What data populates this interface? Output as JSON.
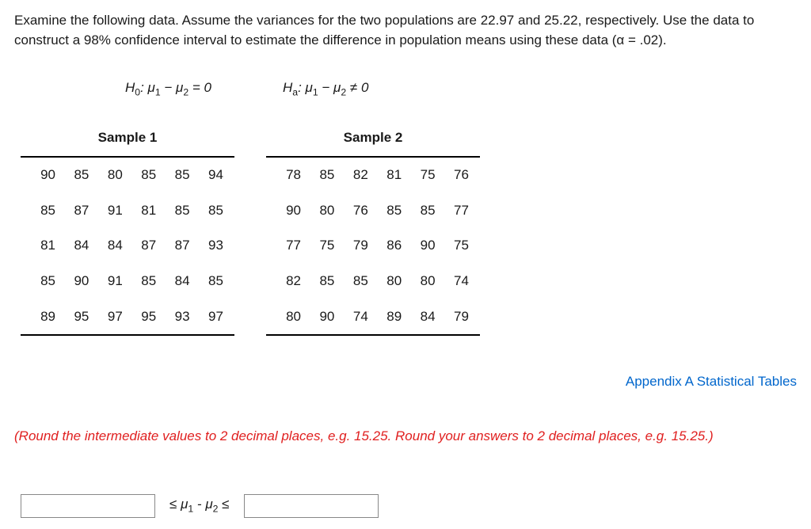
{
  "instructions": "Examine the following data. Assume the variances for the two populations are 22.97 and 25.22, respectively. Use the data to construct a 98% confidence interval to estimate the difference in population means using these data (α = .02).",
  "hypotheses": {
    "h0_prefix": "H",
    "h0_sub": "0",
    "h0_body": ": μ",
    "h0_s1": "1",
    "h0_mid": " − μ",
    "h0_s2": "2",
    "h0_end": " = 0",
    "ha_prefix": "H",
    "ha_sub": "a",
    "ha_body": ": μ",
    "ha_s1": "1",
    "ha_mid": " − μ",
    "ha_s2": "2",
    "ha_end": " ≠ 0"
  },
  "samples": [
    {
      "title": "Sample 1",
      "rows": [
        [
          "90",
          "85",
          "80",
          "85",
          "85",
          "94"
        ],
        [
          "85",
          "87",
          "91",
          "81",
          "85",
          "85"
        ],
        [
          "81",
          "84",
          "84",
          "87",
          "87",
          "93"
        ],
        [
          "85",
          "90",
          "91",
          "85",
          "84",
          "85"
        ],
        [
          "89",
          "95",
          "97",
          "95",
          "93",
          "97"
        ]
      ]
    },
    {
      "title": "Sample 2",
      "rows": [
        [
          "78",
          "85",
          "82",
          "81",
          "75",
          "76"
        ],
        [
          "90",
          "80",
          "76",
          "85",
          "85",
          "77"
        ],
        [
          "77",
          "75",
          "79",
          "86",
          "90",
          "75"
        ],
        [
          "82",
          "85",
          "85",
          "80",
          "80",
          "74"
        ],
        [
          "80",
          "90",
          "74",
          "89",
          "84",
          "79"
        ]
      ]
    }
  ],
  "appendix_link": "Appendix A Statistical Tables",
  "rounding_note": "(Round the intermediate values to 2 decimal places, e.g. 15.25. Round your answers to 2 decimal places, e.g. 15.25.)",
  "answer": {
    "leq1": "≤ ",
    "mu": "μ",
    "s1": "1",
    "minus": " - ",
    "s2": "2",
    "leq2": " ≤"
  }
}
